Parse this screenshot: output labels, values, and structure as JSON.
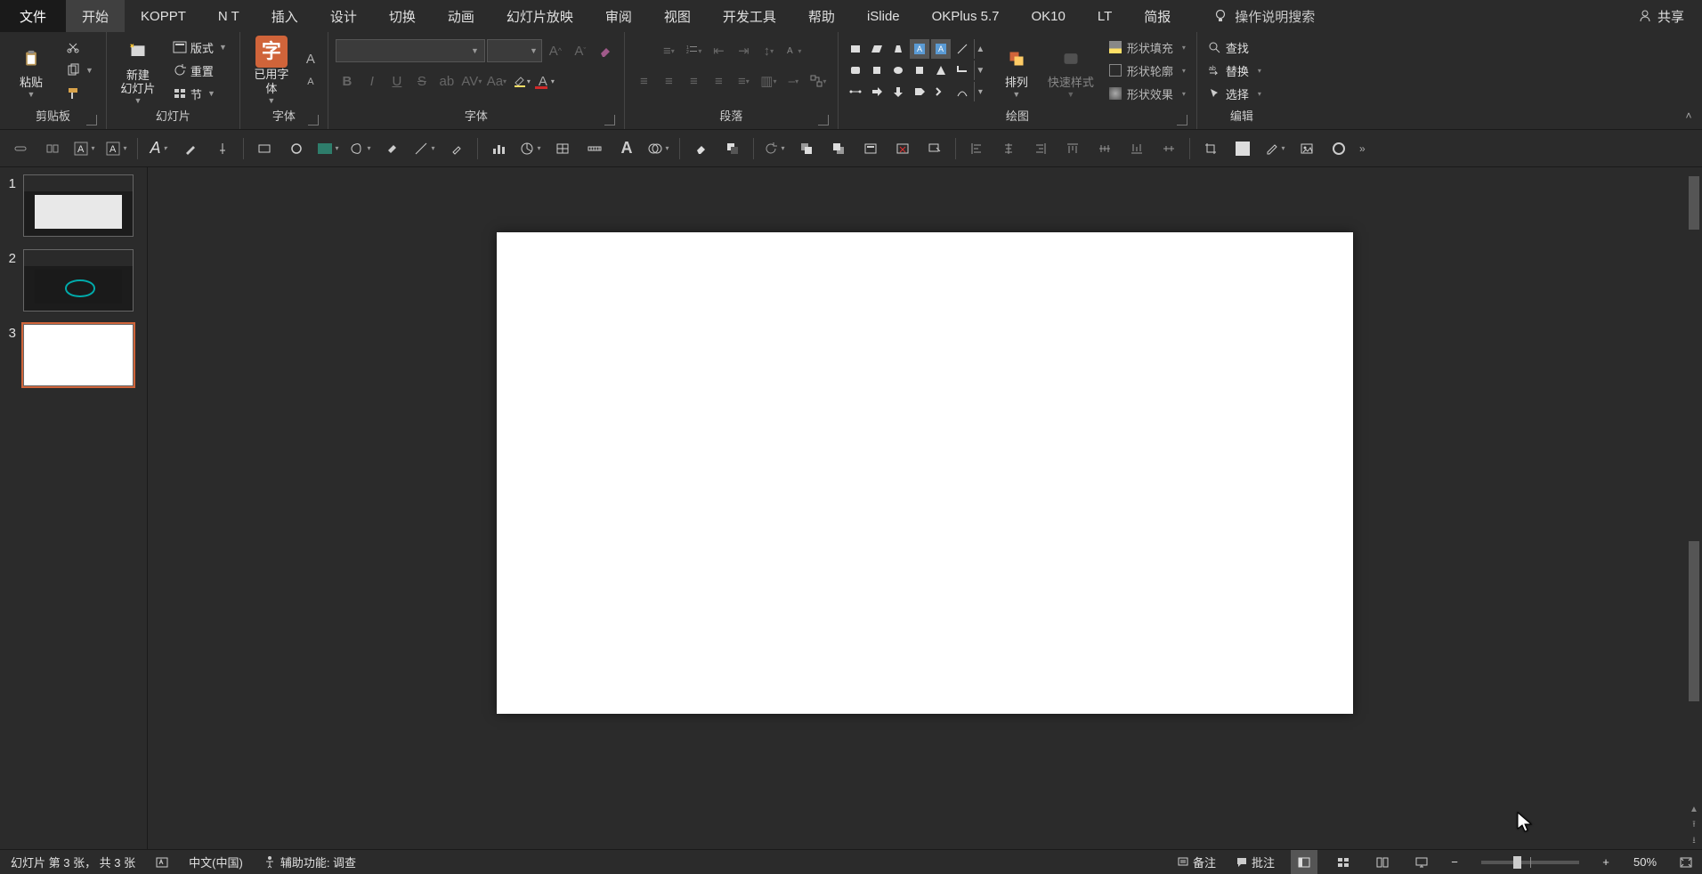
{
  "tabs": {
    "file": "文件",
    "home": "开始",
    "list": [
      "KOPPT",
      "N T",
      "插入",
      "设计",
      "切换",
      "动画",
      "幻灯片放映",
      "审阅",
      "视图",
      "开发工具",
      "帮助",
      "iSlide",
      "OKPlus 5.7",
      "OK10",
      "LT",
      "简报"
    ],
    "search": "操作说明搜索",
    "share": "共享"
  },
  "ribbon": {
    "group1": {
      "label": "剪贴板",
      "paste": "粘贴"
    },
    "group2": {
      "label": "幻灯片",
      "new": "新建\n幻灯片",
      "layout": "版式",
      "reset": "重置",
      "section": "节"
    },
    "group3": {
      "label": "字体",
      "usedFonts": "已用字\n体"
    },
    "group4": {
      "label": "段落"
    },
    "group5": {
      "label": "绘图",
      "arrange": "排列",
      "quick": "快速样式",
      "fill": "形状填充",
      "outline": "形状轮廓",
      "effects": "形状效果"
    },
    "group6": {
      "label": "编辑",
      "find": "查找",
      "replace": "替换",
      "select": "选择"
    },
    "fontName": "",
    "fontSize": ""
  },
  "slides": [
    {
      "num": "1",
      "sel": false,
      "kind": "content"
    },
    {
      "num": "2",
      "sel": false,
      "kind": "dark"
    },
    {
      "num": "3",
      "sel": true,
      "kind": "blank"
    }
  ],
  "status": {
    "slideInfo": "幻灯片 第 3 张， 共 3 张",
    "lang": "中文(中国)",
    "a11y": "辅助功能: 调查",
    "notes": "备注",
    "comments": "批注",
    "zoom": "50%"
  }
}
